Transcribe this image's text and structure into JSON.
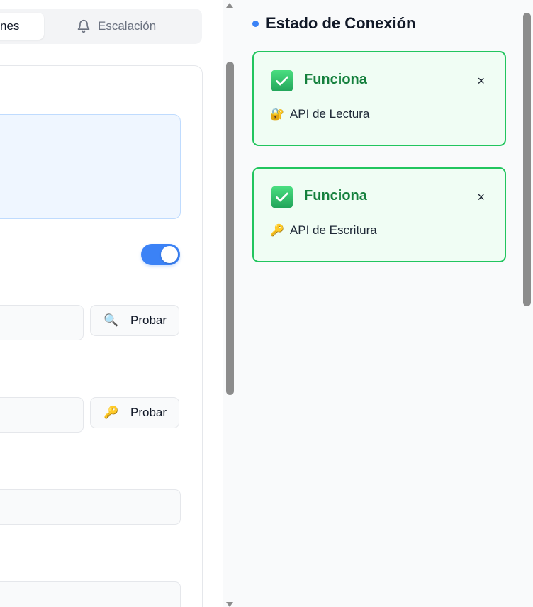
{
  "tabs": {
    "active_label": "nes",
    "escalation_label": "Escalación",
    "escalation_icon": "bell-icon"
  },
  "settings": {
    "toggle_on": true,
    "probe_buttons": [
      {
        "emoji": "🔍",
        "icon": "magnifier-icon",
        "label": "Probar"
      },
      {
        "emoji": "🔑",
        "icon": "key-icon",
        "label": "Probar"
      }
    ]
  },
  "status_panel": {
    "title": "Estado de Conexión",
    "accent_color": "#3b82f6",
    "cards": [
      {
        "status": "Funciona",
        "api_emoji": "🔐",
        "api_icon": "lock-icon",
        "api_label": "API de Lectura",
        "close_label": "×"
      },
      {
        "status": "Funciona",
        "api_emoji": "🔑",
        "api_icon": "key-icon",
        "api_label": "API de Escritura",
        "close_label": "×"
      }
    ],
    "success_color": "#22c55e"
  }
}
